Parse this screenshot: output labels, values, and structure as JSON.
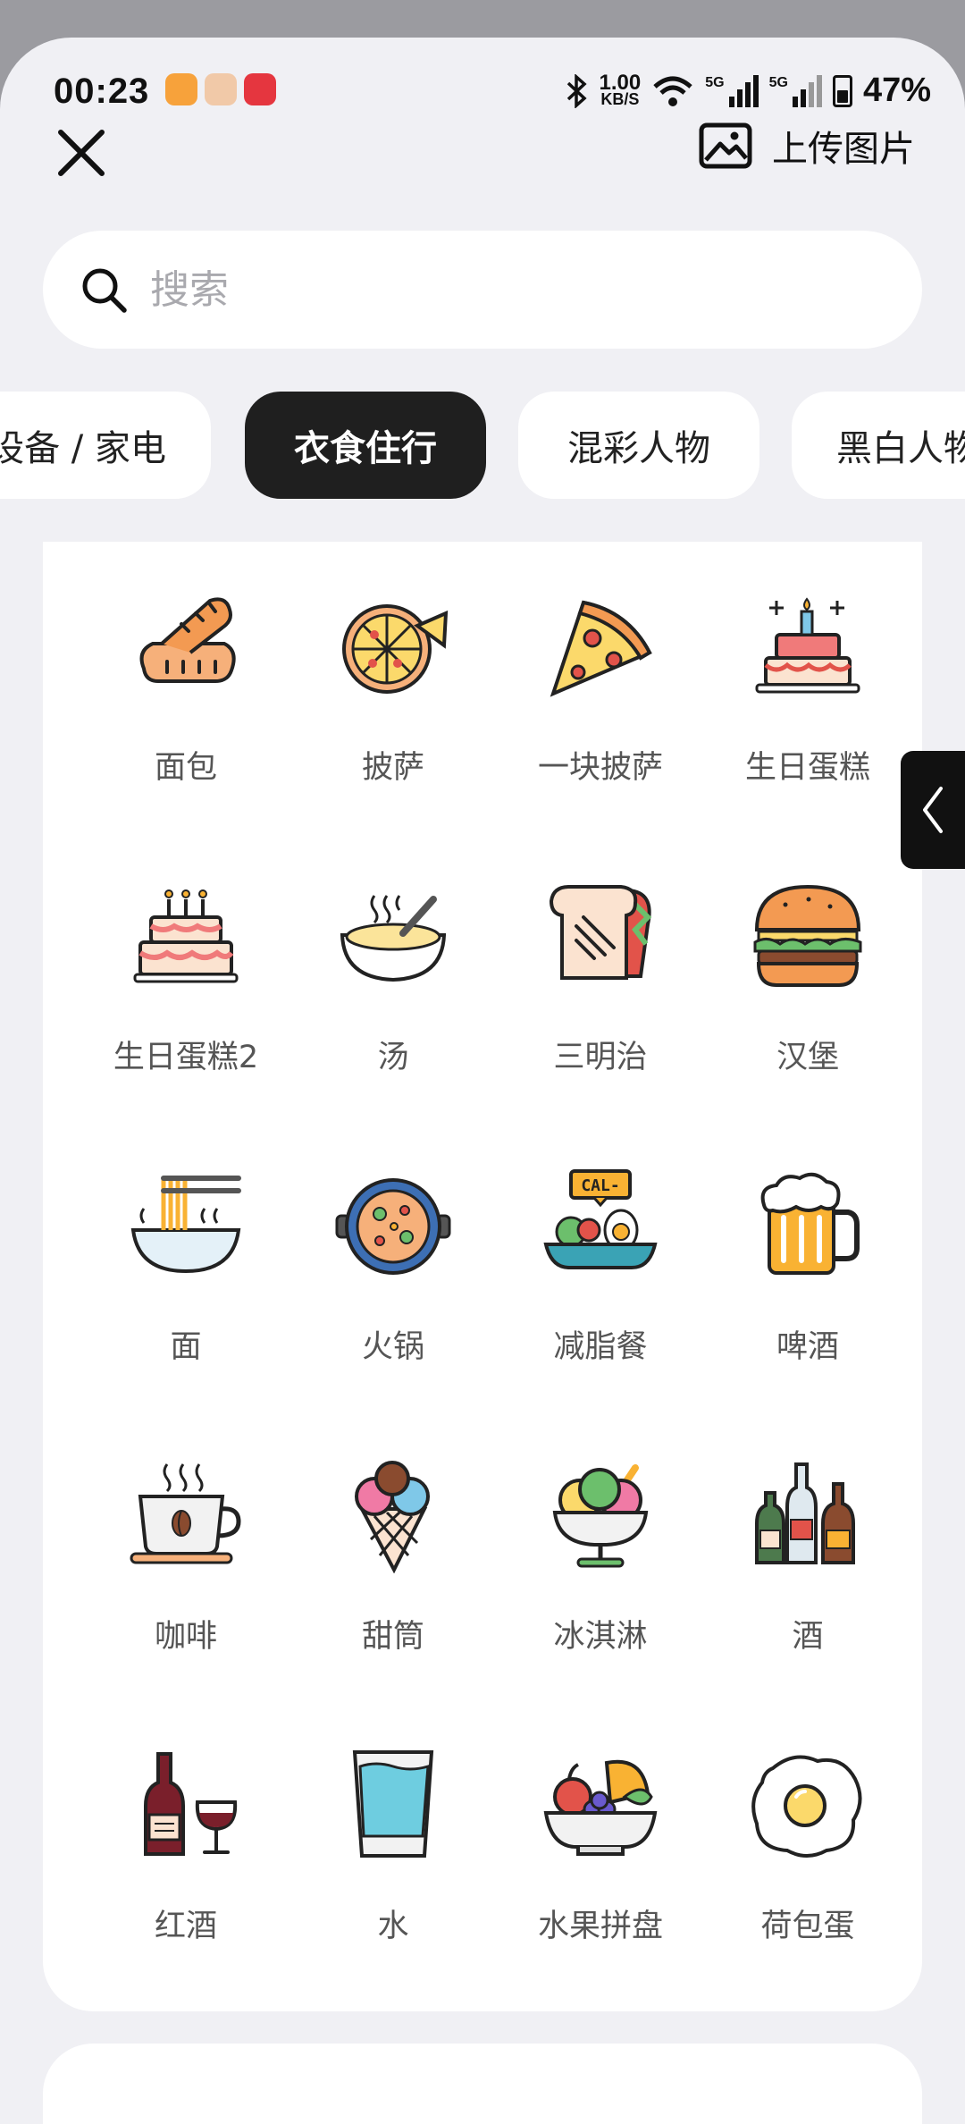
{
  "status_bar": {
    "time": "00:23",
    "net_speed_value": "1.00",
    "net_speed_unit": "KB/S",
    "sim1": "5G",
    "sim2": "5G",
    "battery": "47%"
  },
  "header": {
    "upload_label": "上传图片"
  },
  "search": {
    "placeholder": "搜索"
  },
  "tabs": [
    {
      "label": "设备 / 家电",
      "active": false
    },
    {
      "label": "衣食住行",
      "active": true
    },
    {
      "label": "混彩人物",
      "active": false
    },
    {
      "label": "黑白人物",
      "active": false
    }
  ],
  "icons": [
    {
      "label": "面包",
      "icon": "bread-icon"
    },
    {
      "label": "披萨",
      "icon": "pizza-icon"
    },
    {
      "label": "一块披萨",
      "icon": "pizza-slice-icon"
    },
    {
      "label": "生日蛋糕",
      "icon": "birthday-cake-icon"
    },
    {
      "label": "生日蛋糕2",
      "icon": "birthday-cake-2-icon"
    },
    {
      "label": "汤",
      "icon": "soup-icon"
    },
    {
      "label": "三明治",
      "icon": "sandwich-icon"
    },
    {
      "label": "汉堡",
      "icon": "burger-icon"
    },
    {
      "label": "面",
      "icon": "noodles-icon"
    },
    {
      "label": "火锅",
      "icon": "hotpot-icon"
    },
    {
      "label": "减脂餐",
      "icon": "diet-meal-icon"
    },
    {
      "label": "啤酒",
      "icon": "beer-icon"
    },
    {
      "label": "咖啡",
      "icon": "coffee-icon"
    },
    {
      "label": "甜筒",
      "icon": "ice-cream-cone-icon"
    },
    {
      "label": "冰淇淋",
      "icon": "ice-cream-cup-icon"
    },
    {
      "label": "酒",
      "icon": "liquor-icon"
    },
    {
      "label": "红酒",
      "icon": "red-wine-icon"
    },
    {
      "label": "水",
      "icon": "water-glass-icon"
    },
    {
      "label": "水果拼盘",
      "icon": "fruit-platter-icon"
    },
    {
      "label": "荷包蛋",
      "icon": "fried-egg-icon"
    }
  ],
  "diet_badge": "CAL-",
  "colors": {
    "sheet_bg": "#f0f0f4",
    "active_tab": "#1f1f1f",
    "label": "#555555"
  }
}
